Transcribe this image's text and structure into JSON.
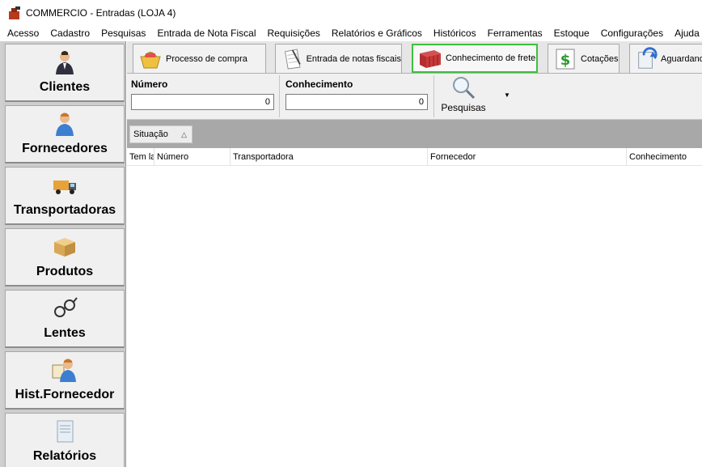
{
  "window": {
    "title": "COMMERCIO - Entradas (LOJA 4)"
  },
  "menu": [
    "Acesso",
    "Cadastro",
    "Pesquisas",
    "Entrada de Nota Fiscal",
    "Requisições",
    "Relatórios e Gráficos",
    "Históricos",
    "Ferramentas",
    "Estoque",
    "Configurações",
    "Ajuda"
  ],
  "sidebar": {
    "items": [
      {
        "label": "Clientes",
        "icon": "person-icon"
      },
      {
        "label": "Fornecedores",
        "icon": "person-icon"
      },
      {
        "label": "Transportadoras",
        "icon": "truck-icon"
      },
      {
        "label": "Produtos",
        "icon": "box-icon"
      },
      {
        "label": "Lentes",
        "icon": "glasses-icon"
      },
      {
        "label": "Hist.Fornecedor",
        "icon": "person-card-icon"
      },
      {
        "label": "Relatórios",
        "icon": "document-icon"
      }
    ]
  },
  "tabs": [
    {
      "label": "Processo de compra",
      "icon": "basket-icon"
    },
    {
      "label": "Entrada de notas fiscais",
      "icon": "notepad-icon"
    },
    {
      "label": "Conhecimento de frete",
      "icon": "container-icon",
      "selected": true
    },
    {
      "label": "Cotações",
      "icon": "dollar-icon"
    },
    {
      "label": "Aguardando",
      "icon": "refresh-doc-icon"
    }
  ],
  "filters": {
    "numero": {
      "label": "Número",
      "value": "0"
    },
    "conhecimento": {
      "label": "Conhecimento",
      "value": "0"
    },
    "search_label": "Pesquisas"
  },
  "grouping": {
    "label": "Situação"
  },
  "grid": {
    "columns": [
      "Tem la",
      "Número",
      "Transportadora",
      "Fornecedor",
      "Conhecimento"
    ]
  },
  "colors": {
    "highlight": "#3fbf3f",
    "groupbar": "#a8a8a8",
    "sidebar": "#cdcdcd"
  }
}
